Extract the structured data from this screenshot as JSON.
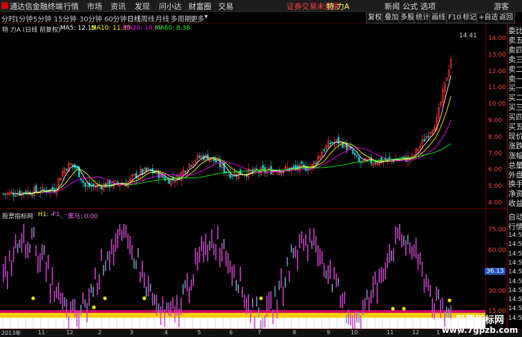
{
  "menu": {
    "app_title": "通达信金融终端",
    "items": [
      "行情",
      "市场",
      "资讯",
      "发现",
      "问小达",
      "财富圈",
      "交易"
    ],
    "alert": "证券交易未登录",
    "stock": "特 力A",
    "right_items": [
      "新闻",
      "公式",
      "选项",
      "游客"
    ]
  },
  "periods": {
    "items": [
      "分时",
      "1分钟",
      "5分钟",
      "15分钟",
      "30分钟",
      "60分钟",
      "日线",
      "周线",
      "月线",
      "多周期",
      "更多"
    ],
    "active": "日线",
    "tools": [
      "复权",
      "叠加",
      "多股",
      "统计",
      "画线",
      "F10",
      "标记",
      "+自选",
      "返回"
    ]
  },
  "legend": {
    "title": "特 力A (日线 前复权)",
    "ma5": "MA5: 12.15",
    "ma10": "MA10: 11.35",
    "ma20": "MA20: 10.69",
    "ma60": "MA60: 8.38",
    "indicator_name": "股票指标网",
    "h1": "H1: -",
    "f1": "F1_ -",
    "black_horse": "黑马: 0.00"
  },
  "price_axis": [
    "14.00",
    "13.00",
    "12.00",
    "11.00",
    "10.00",
    "9.00",
    "8.00",
    "7.00",
    "6.00",
    "5.00",
    "4.00"
  ],
  "high_label": "14.41",
  "indicator_axis": [
    "75.00",
    "60.00",
    "45.00",
    "30.00",
    "15.00"
  ],
  "indicator_current": "36.13",
  "right_panel": {
    "top": [
      "委比",
      "卖五",
      "卖四",
      "卖三",
      "卖二",
      "卖一",
      "买一",
      "买二",
      "买三",
      "买四",
      "买五",
      "现价",
      "涨跌",
      "涨幅",
      "总量",
      "外盘",
      "换手",
      "净资",
      "收益"
    ],
    "mid": [
      "自动",
      "行情"
    ],
    "times": [
      "14:5",
      "14:5",
      "14:5",
      "14:5",
      "14:5",
      "14:5",
      "14:5",
      "14:5",
      "14:5",
      "14:5"
    ]
  },
  "date_axis": [
    "2013年",
    "11",
    "12",
    "2",
    "3",
    "4",
    "5",
    "6",
    "7",
    "8",
    "9",
    "10",
    "11",
    "12",
    "1",
    "2"
  ],
  "watermark": {
    "title": "股票指标网",
    "url": "www.7gpzb.com"
  },
  "colors": {
    "ma5": "#ffffff",
    "ma10": "#ffff00",
    "ma20": "#ff00ff",
    "ma60": "#00ff00",
    "up": "#ff3333",
    "down": "#00cccc"
  }
}
